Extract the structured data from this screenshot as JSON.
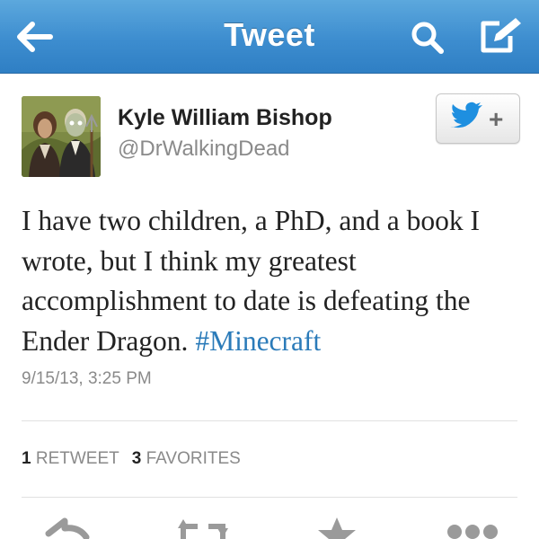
{
  "nav": {
    "title": "Tweet",
    "icons": [
      "back-arrow-icon",
      "search-icon",
      "compose-icon"
    ],
    "bar_color": "#3d8dcf"
  },
  "tweet": {
    "author_name": "Kyle William Bishop",
    "author_handle": "@DrWalkingDead",
    "text": "I have two children, a PhD, and a book I wrote, but I think my greatest accomplishment to date is defeating the Ender Dragon. ",
    "hashtag": "#Minecraft",
    "hashtag_color": "#2b7bb9",
    "timestamp": "9/15/13, 3:25 PM"
  },
  "follow": {
    "icon": "twitter-bird-plus-icon",
    "plus": "+",
    "bird_color": "#1e8fe0"
  },
  "stats": {
    "retweet_count": "1",
    "retweet_label": "RETWEET",
    "favorite_count": "3",
    "favorite_label": "FAVORITES"
  },
  "actions": [
    "reply-icon",
    "retweet-icon",
    "favorite-star-icon",
    "more-icon"
  ]
}
